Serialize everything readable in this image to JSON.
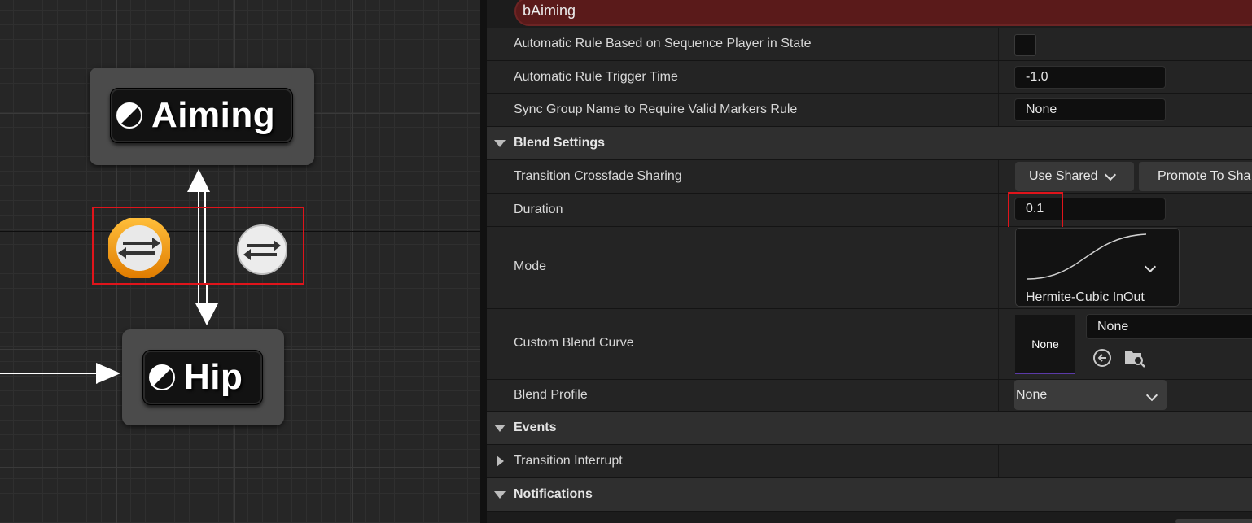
{
  "graph": {
    "states": [
      {
        "name": "Aiming"
      },
      {
        "name": "Hip"
      }
    ]
  },
  "details": {
    "banner_text": "bAiming",
    "rows": {
      "auto_rule_label": "Automatic Rule Based on Sequence Player in State",
      "auto_rule_checked": false,
      "trigger_time_label": "Automatic Rule Trigger Time",
      "trigger_time_value": "-1.0",
      "sync_group_label": "Sync Group Name to Require Valid Markers Rule",
      "sync_group_value": "None",
      "crossfade_label": "Transition Crossfade Sharing",
      "crossfade_value": "Use Shared",
      "promote_label": "Promote To Sha",
      "duration_label": "Duration",
      "duration_value": "0.1",
      "mode_label": "Mode",
      "mode_value": "Hermite-Cubic InOut",
      "custom_curve_label": "Custom Blend Curve",
      "custom_curve_thumb": "None",
      "custom_curve_value": "None",
      "blend_profile_label": "Blend Profile",
      "blend_profile_value": "None",
      "transition_interrupt_label": "Transition Interrupt"
    },
    "categories": {
      "blend_settings": "Blend Settings",
      "events": "Events",
      "notifications": "Notifications"
    }
  },
  "colors": {
    "selection_red": "#e0141b",
    "banner_red": "#5a1a1a",
    "transition_active": "#f39a12",
    "transition_inactive": "#e6e6e6"
  }
}
